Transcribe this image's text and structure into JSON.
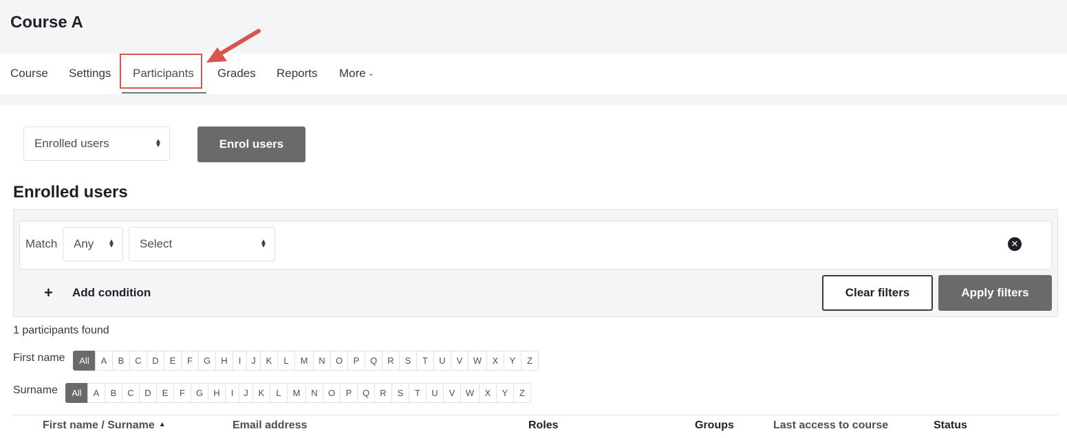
{
  "page": {
    "course_title": "Course A"
  },
  "nav": {
    "tabs": [
      {
        "label": "Course"
      },
      {
        "label": "Settings"
      },
      {
        "label": "Participants"
      },
      {
        "label": "Grades"
      },
      {
        "label": "Reports"
      },
      {
        "label": "More"
      }
    ],
    "active": "Participants"
  },
  "controls": {
    "enrol_select_value": "Enrolled users",
    "enrol_button": "Enrol users"
  },
  "section": {
    "heading": "Enrolled users"
  },
  "filters": {
    "match_label": "Match",
    "match_value": "Any",
    "type_value": "Select",
    "add_condition": "Add condition",
    "clear_button": "Clear filters",
    "apply_button": "Apply filters"
  },
  "results": {
    "count_text": "1 participants found"
  },
  "initials": {
    "first_name_label": "First name",
    "surname_label": "Surname",
    "letters": [
      "All",
      "A",
      "B",
      "C",
      "D",
      "E",
      "F",
      "G",
      "H",
      "I",
      "J",
      "K",
      "L",
      "M",
      "N",
      "O",
      "P",
      "Q",
      "R",
      "S",
      "T",
      "U",
      "V",
      "W",
      "X",
      "Y",
      "Z"
    ],
    "selected": "All"
  },
  "table": {
    "columns": [
      "First name / Surname",
      "Email address",
      "Roles",
      "Groups",
      "Last access to course",
      "Status"
    ],
    "sorted_column": "First name / Surname",
    "sort_direction": "ascending"
  },
  "colors": {
    "annotation_red": "#d9534f",
    "button_dark": "#6a6a6a",
    "page_band": "#f4f5f7"
  }
}
